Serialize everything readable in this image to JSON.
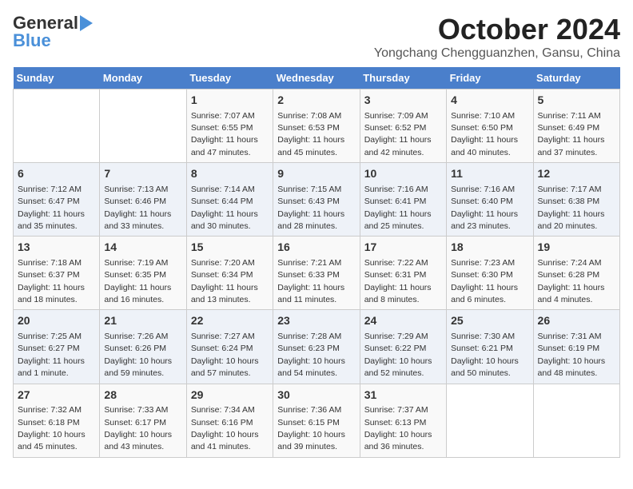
{
  "logo": {
    "line1": "General",
    "line2": "Blue"
  },
  "title": "October 2024",
  "subtitle": "Yongchang Chengguanzhen, Gansu, China",
  "days_of_week": [
    "Sunday",
    "Monday",
    "Tuesday",
    "Wednesday",
    "Thursday",
    "Friday",
    "Saturday"
  ],
  "weeks": [
    [
      {
        "day": "",
        "sunrise": "",
        "sunset": "",
        "daylight": ""
      },
      {
        "day": "",
        "sunrise": "",
        "sunset": "",
        "daylight": ""
      },
      {
        "day": "1",
        "sunrise": "Sunrise: 7:07 AM",
        "sunset": "Sunset: 6:55 PM",
        "daylight": "Daylight: 11 hours and 47 minutes."
      },
      {
        "day": "2",
        "sunrise": "Sunrise: 7:08 AM",
        "sunset": "Sunset: 6:53 PM",
        "daylight": "Daylight: 11 hours and 45 minutes."
      },
      {
        "day": "3",
        "sunrise": "Sunrise: 7:09 AM",
        "sunset": "Sunset: 6:52 PM",
        "daylight": "Daylight: 11 hours and 42 minutes."
      },
      {
        "day": "4",
        "sunrise": "Sunrise: 7:10 AM",
        "sunset": "Sunset: 6:50 PM",
        "daylight": "Daylight: 11 hours and 40 minutes."
      },
      {
        "day": "5",
        "sunrise": "Sunrise: 7:11 AM",
        "sunset": "Sunset: 6:49 PM",
        "daylight": "Daylight: 11 hours and 37 minutes."
      }
    ],
    [
      {
        "day": "6",
        "sunrise": "Sunrise: 7:12 AM",
        "sunset": "Sunset: 6:47 PM",
        "daylight": "Daylight: 11 hours and 35 minutes."
      },
      {
        "day": "7",
        "sunrise": "Sunrise: 7:13 AM",
        "sunset": "Sunset: 6:46 PM",
        "daylight": "Daylight: 11 hours and 33 minutes."
      },
      {
        "day": "8",
        "sunrise": "Sunrise: 7:14 AM",
        "sunset": "Sunset: 6:44 PM",
        "daylight": "Daylight: 11 hours and 30 minutes."
      },
      {
        "day": "9",
        "sunrise": "Sunrise: 7:15 AM",
        "sunset": "Sunset: 6:43 PM",
        "daylight": "Daylight: 11 hours and 28 minutes."
      },
      {
        "day": "10",
        "sunrise": "Sunrise: 7:16 AM",
        "sunset": "Sunset: 6:41 PM",
        "daylight": "Daylight: 11 hours and 25 minutes."
      },
      {
        "day": "11",
        "sunrise": "Sunrise: 7:16 AM",
        "sunset": "Sunset: 6:40 PM",
        "daylight": "Daylight: 11 hours and 23 minutes."
      },
      {
        "day": "12",
        "sunrise": "Sunrise: 7:17 AM",
        "sunset": "Sunset: 6:38 PM",
        "daylight": "Daylight: 11 hours and 20 minutes."
      }
    ],
    [
      {
        "day": "13",
        "sunrise": "Sunrise: 7:18 AM",
        "sunset": "Sunset: 6:37 PM",
        "daylight": "Daylight: 11 hours and 18 minutes."
      },
      {
        "day": "14",
        "sunrise": "Sunrise: 7:19 AM",
        "sunset": "Sunset: 6:35 PM",
        "daylight": "Daylight: 11 hours and 16 minutes."
      },
      {
        "day": "15",
        "sunrise": "Sunrise: 7:20 AM",
        "sunset": "Sunset: 6:34 PM",
        "daylight": "Daylight: 11 hours and 13 minutes."
      },
      {
        "day": "16",
        "sunrise": "Sunrise: 7:21 AM",
        "sunset": "Sunset: 6:33 PM",
        "daylight": "Daylight: 11 hours and 11 minutes."
      },
      {
        "day": "17",
        "sunrise": "Sunrise: 7:22 AM",
        "sunset": "Sunset: 6:31 PM",
        "daylight": "Daylight: 11 hours and 8 minutes."
      },
      {
        "day": "18",
        "sunrise": "Sunrise: 7:23 AM",
        "sunset": "Sunset: 6:30 PM",
        "daylight": "Daylight: 11 hours and 6 minutes."
      },
      {
        "day": "19",
        "sunrise": "Sunrise: 7:24 AM",
        "sunset": "Sunset: 6:28 PM",
        "daylight": "Daylight: 11 hours and 4 minutes."
      }
    ],
    [
      {
        "day": "20",
        "sunrise": "Sunrise: 7:25 AM",
        "sunset": "Sunset: 6:27 PM",
        "daylight": "Daylight: 11 hours and 1 minute."
      },
      {
        "day": "21",
        "sunrise": "Sunrise: 7:26 AM",
        "sunset": "Sunset: 6:26 PM",
        "daylight": "Daylight: 10 hours and 59 minutes."
      },
      {
        "day": "22",
        "sunrise": "Sunrise: 7:27 AM",
        "sunset": "Sunset: 6:24 PM",
        "daylight": "Daylight: 10 hours and 57 minutes."
      },
      {
        "day": "23",
        "sunrise": "Sunrise: 7:28 AM",
        "sunset": "Sunset: 6:23 PM",
        "daylight": "Daylight: 10 hours and 54 minutes."
      },
      {
        "day": "24",
        "sunrise": "Sunrise: 7:29 AM",
        "sunset": "Sunset: 6:22 PM",
        "daylight": "Daylight: 10 hours and 52 minutes."
      },
      {
        "day": "25",
        "sunrise": "Sunrise: 7:30 AM",
        "sunset": "Sunset: 6:21 PM",
        "daylight": "Daylight: 10 hours and 50 minutes."
      },
      {
        "day": "26",
        "sunrise": "Sunrise: 7:31 AM",
        "sunset": "Sunset: 6:19 PM",
        "daylight": "Daylight: 10 hours and 48 minutes."
      }
    ],
    [
      {
        "day": "27",
        "sunrise": "Sunrise: 7:32 AM",
        "sunset": "Sunset: 6:18 PM",
        "daylight": "Daylight: 10 hours and 45 minutes."
      },
      {
        "day": "28",
        "sunrise": "Sunrise: 7:33 AM",
        "sunset": "Sunset: 6:17 PM",
        "daylight": "Daylight: 10 hours and 43 minutes."
      },
      {
        "day": "29",
        "sunrise": "Sunrise: 7:34 AM",
        "sunset": "Sunset: 6:16 PM",
        "daylight": "Daylight: 10 hours and 41 minutes."
      },
      {
        "day": "30",
        "sunrise": "Sunrise: 7:36 AM",
        "sunset": "Sunset: 6:15 PM",
        "daylight": "Daylight: 10 hours and 39 minutes."
      },
      {
        "day": "31",
        "sunrise": "Sunrise: 7:37 AM",
        "sunset": "Sunset: 6:13 PM",
        "daylight": "Daylight: 10 hours and 36 minutes."
      },
      {
        "day": "",
        "sunrise": "",
        "sunset": "",
        "daylight": ""
      },
      {
        "day": "",
        "sunrise": "",
        "sunset": "",
        "daylight": ""
      }
    ]
  ]
}
